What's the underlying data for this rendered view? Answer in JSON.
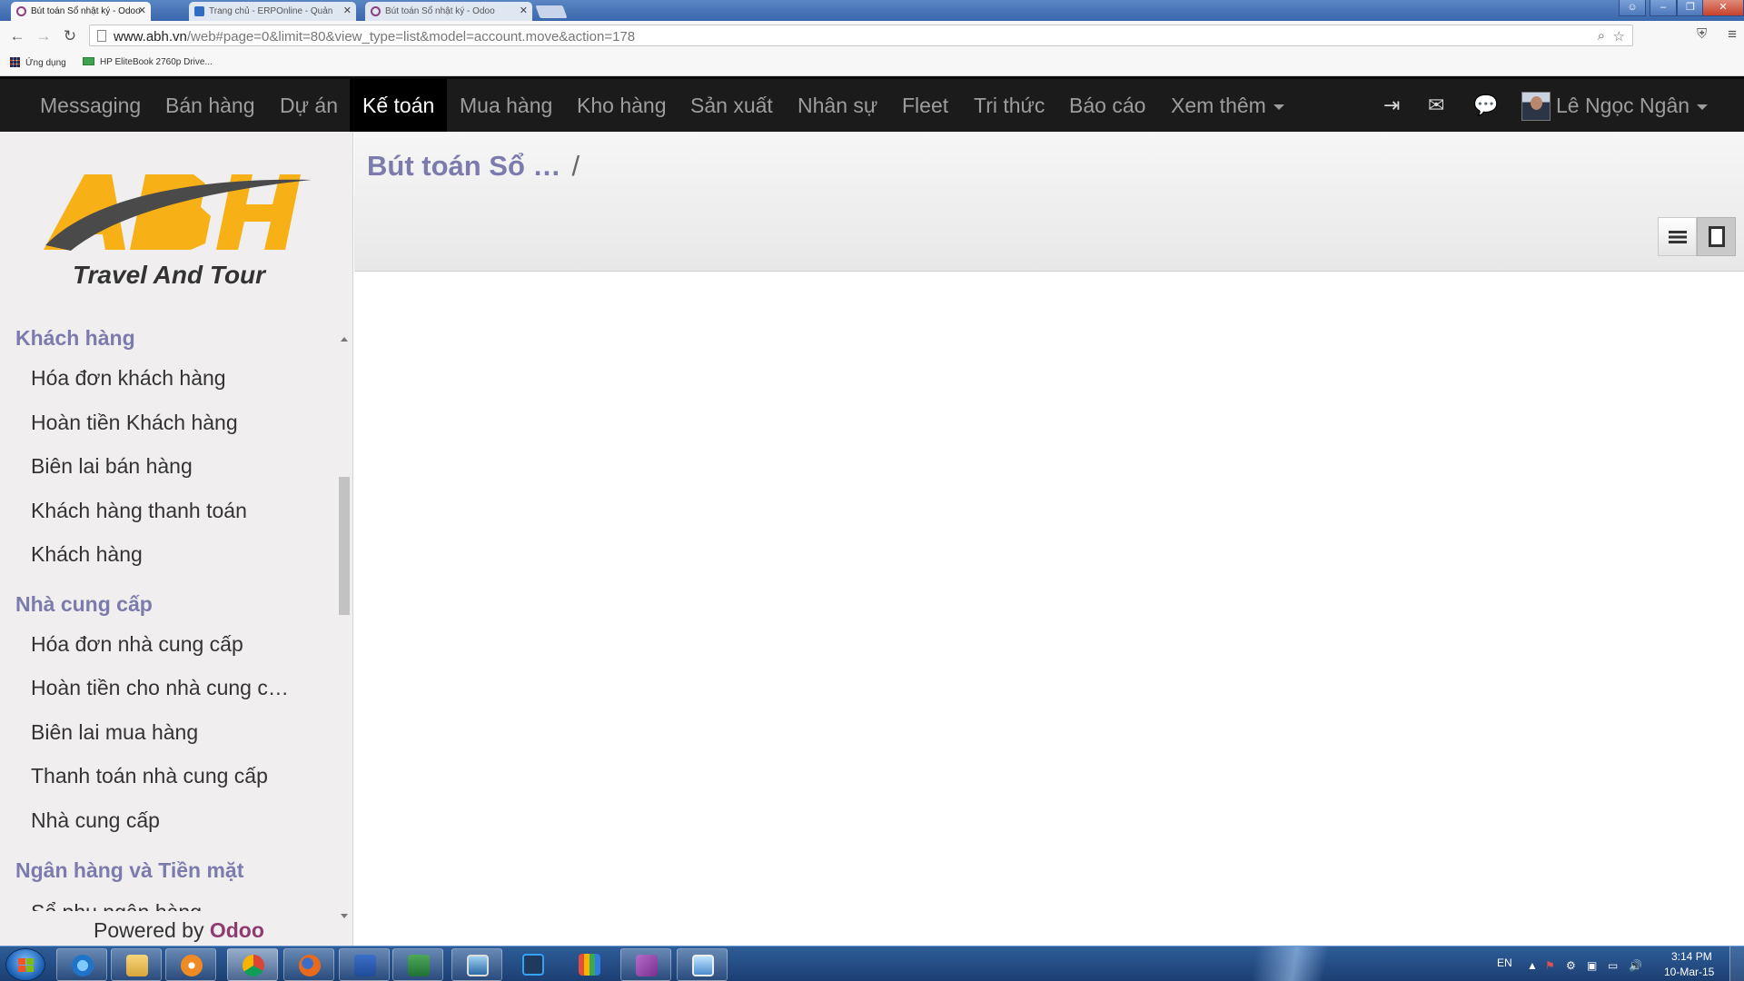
{
  "browser": {
    "tabs": [
      {
        "title": "Bút toán Sổ nhật ký - Odoo",
        "active": true
      },
      {
        "title": "Trang chủ - ERPOnline - Quản",
        "active": false
      },
      {
        "title": "Bút toán Sổ nhật ký - Odoo",
        "active": false
      }
    ],
    "url_host": "www.abh.vn",
    "url_path": "/web#page=0&limit=80&view_type=list&model=account.move&action=178",
    "bookmarks": [
      "Ứng dụng",
      "HP EliteBook 2760p Drive..."
    ]
  },
  "odoo": {
    "top_menu": [
      "Messaging",
      "Bán hàng",
      "Dự án",
      "Kế toán",
      "Mua hàng",
      "Kho hàng",
      "Sản xuất",
      "Nhân sự",
      "Fleet",
      "Tri thức",
      "Báo cáo",
      "Xem thêm"
    ],
    "active_menu": "Kế toán",
    "user_name": "Lê Ngọc Ngân",
    "logo": {
      "brand": "ABH",
      "tagline": "Travel And Tour"
    },
    "sidebar": {
      "customers": {
        "heading": "Khách hàng",
        "items": [
          "Hóa đơn khách hàng",
          "Hoàn tiền Khách hàng",
          "Biên lai bán hàng",
          "Khách hàng thanh toán",
          "Khách hàng"
        ]
      },
      "suppliers": {
        "heading": "Nhà cung cấp",
        "items": [
          "Hóa đơn nhà cung cấp",
          "Hoàn tiền cho nhà cung c…",
          "Biên lai mua hàng",
          "Thanh toán nhà cung cấp",
          "Nhà cung cấp"
        ]
      },
      "bank": {
        "heading": "Ngân hàng và Tiền mặt",
        "items": [
          "Sổ phụ ngân hàng"
        ]
      }
    },
    "footer": {
      "powered_by": "Powered by",
      "brand": "Odoo"
    },
    "breadcrumb": {
      "title": "Bút toán Sổ …",
      "separator": "/"
    }
  },
  "taskbar": {
    "language": "EN",
    "time": "3:14 PM",
    "date": "10-Mar-15"
  },
  "colors": {
    "odoo_purple": "#7c7bad",
    "odoo_brand": "#8f3b72",
    "topbar": "#1b1b1b",
    "logo_orange": "#f7b116"
  }
}
